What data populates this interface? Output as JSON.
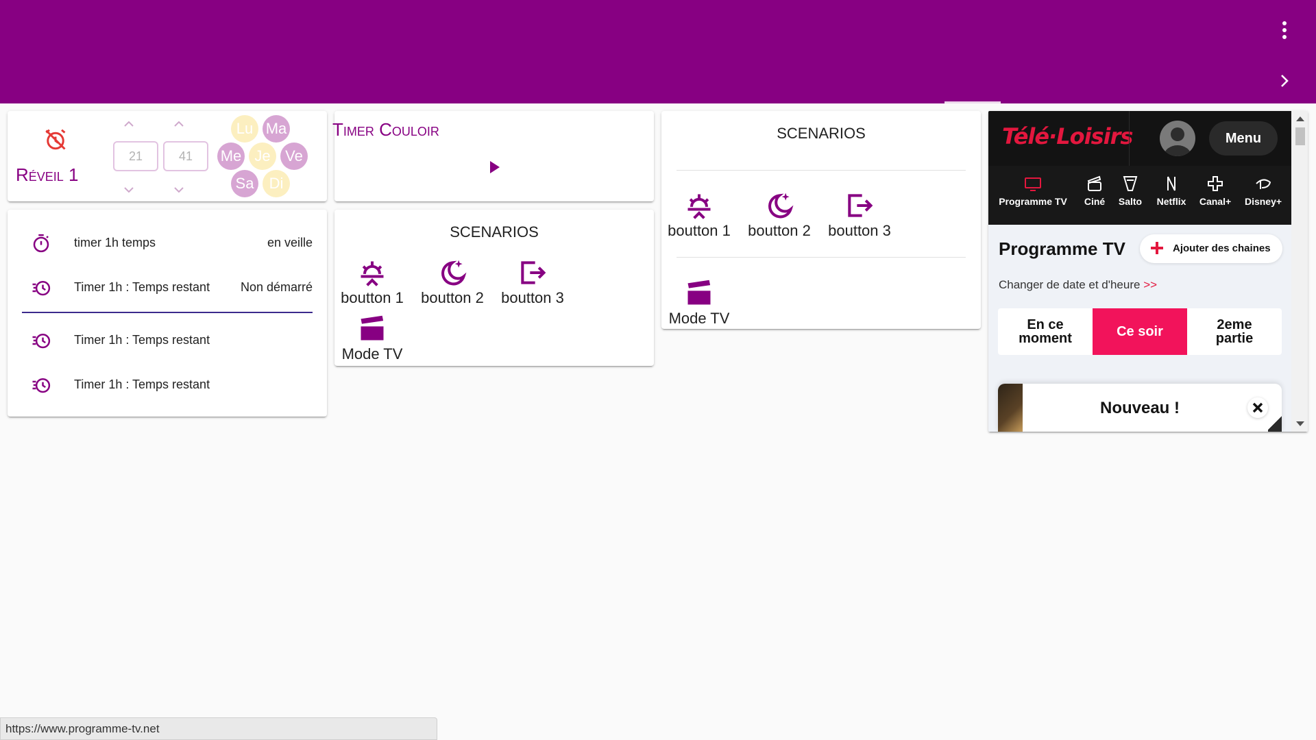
{
  "topbar": {
    "bg": "#870082"
  },
  "alarm": {
    "title": "Réveil 1",
    "hour": "21",
    "minute": "41",
    "days": [
      {
        "label": "Lu",
        "active": false
      },
      {
        "label": "Ma",
        "active": true
      },
      {
        "label": "Me",
        "active": true
      },
      {
        "label": "Je",
        "active": false
      },
      {
        "label": "Ve",
        "active": true
      },
      {
        "label": "Sa",
        "active": true
      },
      {
        "label": "Di",
        "active": false
      }
    ]
  },
  "timers": {
    "rows": [
      {
        "label": "timer 1h temps",
        "value": "en veille",
        "icon": "timer-icon"
      },
      {
        "label": "Timer 1h : Temps restant",
        "value": "Non démarré",
        "icon": "timer-history-icon"
      },
      {
        "label": "Timer 1h : Temps restant",
        "value": "",
        "icon": "timer-history-icon"
      },
      {
        "label": "Timer 1h : Temps restant",
        "value": "",
        "icon": "timer-history-icon"
      }
    ]
  },
  "couloir": {
    "title": "Timer Couloir"
  },
  "scenarios_a": {
    "title": "SCENARIOS",
    "buttons": [
      "boutton 1",
      "boutton 2",
      "boutton 3"
    ],
    "mode": "Mode TV"
  },
  "scenarios_b": {
    "title": "SCENARIOS",
    "buttons": [
      "boutton 1",
      "boutton 2",
      "boutton 3"
    ],
    "mode": "Mode TV"
  },
  "teleloisirs": {
    "logo": "Télé·Loisirs",
    "menu": "Menu",
    "nav": [
      "Programme TV",
      "Ciné",
      "Salto",
      "Netflix",
      "Canal+",
      "Disney+"
    ],
    "heading": "Programme TV",
    "add_button": "Ajouter des chaines",
    "date_link": "Changer de date et d'heure",
    "date_arrow": ">>",
    "tabs": [
      "En ce moment",
      "Ce soir",
      "2eme partie"
    ],
    "banner": "Nouveau !",
    "accent": "#e3173e"
  },
  "statusbar": {
    "url": "https://www.programme-tv.net"
  }
}
